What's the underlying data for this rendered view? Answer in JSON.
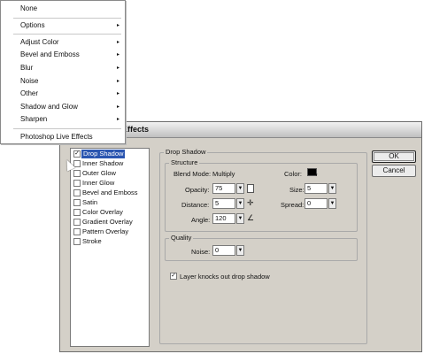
{
  "dialog": {
    "title": "Effects",
    "effects": [
      {
        "label": "Drop Shadow",
        "checked": true,
        "selected": true
      },
      {
        "label": "Inner Shadow",
        "checked": false
      },
      {
        "label": "Outer Glow",
        "checked": false
      },
      {
        "label": "Inner Glow",
        "checked": false
      },
      {
        "label": "Bevel and Emboss",
        "checked": false
      },
      {
        "label": "Satin",
        "checked": false
      },
      {
        "label": "Color Overlay",
        "checked": false
      },
      {
        "label": "Gradient Overlay",
        "checked": false
      },
      {
        "label": "Pattern Overlay",
        "checked": false
      },
      {
        "label": "Stroke",
        "checked": false
      }
    ],
    "panel_title": "Drop Shadow",
    "structure": {
      "label": "Structure",
      "blend_mode_label": "Blend Mode:",
      "blend_mode_value": "Multiply",
      "color_label": "Color:",
      "color_value": "#000000",
      "opacity_label": "Opacity:",
      "opacity_value": "75",
      "size_label": "Size:",
      "size_value": "5",
      "distance_label": "Distance:",
      "distance_value": "5",
      "spread_label": "Spread:",
      "spread_value": "0",
      "angle_label": "Angle:",
      "angle_value": "120"
    },
    "quality": {
      "label": "Quality",
      "noise_label": "Noise:",
      "noise_value": "0"
    },
    "knockout_label": "Layer knocks out drop shadow",
    "knockout_checked": true,
    "ok_label": "OK",
    "cancel_label": "Cancel"
  },
  "menu": {
    "items": [
      {
        "label": "None",
        "submenu": false
      },
      {
        "label": "Options",
        "submenu": true
      },
      {
        "label": "Adjust Color",
        "submenu": true
      },
      {
        "label": "Bevel and Emboss",
        "submenu": true
      },
      {
        "label": "Blur",
        "submenu": true
      },
      {
        "label": "Noise",
        "submenu": true
      },
      {
        "label": "Other",
        "submenu": true
      },
      {
        "label": "Shadow and Glow",
        "submenu": true
      },
      {
        "label": "Sharpen",
        "submenu": true
      },
      {
        "label": "Photoshop Live Effects",
        "submenu": false
      }
    ],
    "arrow_glyph": "▸"
  }
}
